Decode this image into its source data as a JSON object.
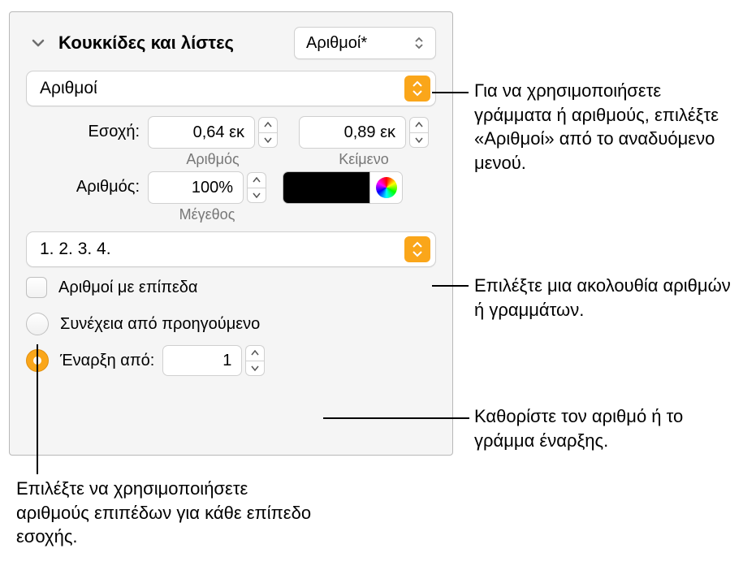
{
  "header": {
    "title": "Κουκκίδες και λίστες",
    "style_dropdown": "Αριθμοί*"
  },
  "type_dropdown": "Αριθμοί",
  "indent": {
    "label": "Εσοχή:",
    "number_value": "0,64 εκ",
    "number_label": "Αριθμός",
    "text_value": "0,89 εκ",
    "text_label": "Κείμενο"
  },
  "number": {
    "label": "Αριθμός:",
    "size_value": "100%",
    "size_label": "Μέγεθος"
  },
  "sequence_dropdown": "1. 2. 3. 4.",
  "tiered": {
    "label": "Αριθμοί με επίπεδα"
  },
  "continue": {
    "label": "Συνέχεια από προηγούμενο"
  },
  "startfrom": {
    "label": "Έναρξη από:",
    "value": "1"
  },
  "callouts": {
    "c1": "Για να χρησιμοποιήσετε γράμματα ή αριθμούς, επιλέξτε «Αριθμοί» από το αναδυόμενο μενού.",
    "c2": "Επιλέξτε μια ακολουθία αριθμών ή γραμμάτων.",
    "c3": "Καθορίστε τον αριθμό ή το γράμμα έναρξης.",
    "c4": "Επιλέξτε να χρησιμοποιήσετε αριθμούς επιπέδων για κάθε επίπεδο εσοχής."
  }
}
